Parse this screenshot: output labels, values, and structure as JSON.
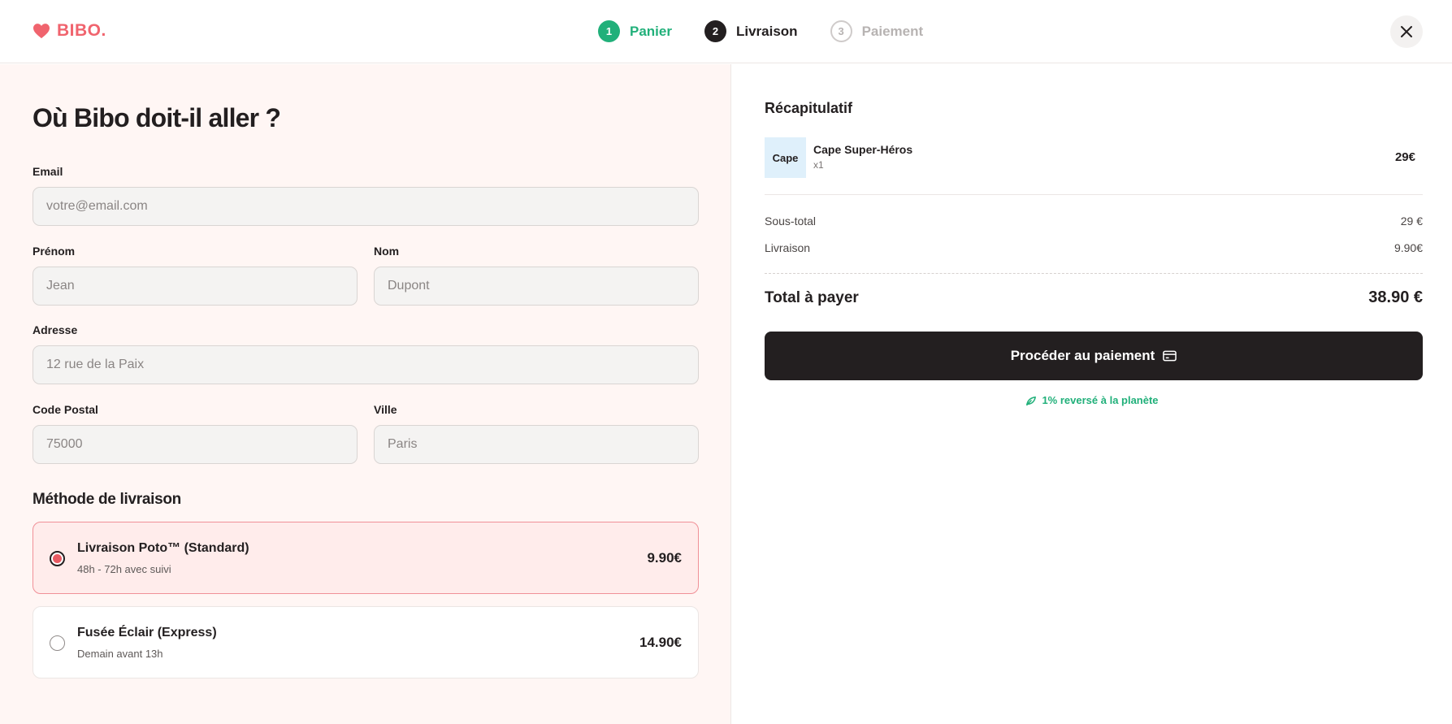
{
  "brand": {
    "name": "BIBO.",
    "color": "#f0646e"
  },
  "steps": [
    {
      "number": "1",
      "label": "Panier",
      "state": "done"
    },
    {
      "number": "2",
      "label": "Livraison",
      "state": "active"
    },
    {
      "number": "3",
      "label": "Paiement",
      "state": "pending"
    }
  ],
  "form": {
    "title": "Où Bibo doit-il aller ?",
    "email": {
      "label": "Email",
      "placeholder": "votre@email.com",
      "value": ""
    },
    "first_name": {
      "label": "Prénom",
      "placeholder": "Jean",
      "value": ""
    },
    "last_name": {
      "label": "Nom",
      "placeholder": "Dupont",
      "value": ""
    },
    "address": {
      "label": "Adresse",
      "placeholder": "12 rue de la Paix",
      "value": ""
    },
    "postal_code": {
      "label": "Code Postal",
      "placeholder": "75000",
      "value": ""
    },
    "city": {
      "label": "Ville",
      "placeholder": "Paris",
      "value": ""
    }
  },
  "shipping": {
    "title": "Méthode de livraison",
    "options": [
      {
        "name": "Livraison Poto™ (Standard)",
        "desc": "48h - 72h avec suivi",
        "price": "9.90€",
        "selected": true
      },
      {
        "name": "Fusée Éclair (Express)",
        "desc": "Demain avant 13h",
        "price": "14.90€",
        "selected": false
      }
    ]
  },
  "summary": {
    "title": "Récapitulatif",
    "item": {
      "thumb_label": "Cape",
      "name": "Cape Super-Héros",
      "qty": "x1",
      "price": "29€"
    },
    "subtotal_label": "Sous-total",
    "subtotal_value": "29 €",
    "shipping_label": "Livraison",
    "shipping_value": "9.90€",
    "total_label": "Total à payer",
    "total_value": "38.90 €",
    "pay_button": "Procéder au paiement",
    "eco_note": "1% reversé à la planète"
  },
  "colors": {
    "accent_green": "#21b07a",
    "dark": "#231f20",
    "selected_bg": "#ffeceb"
  },
  "icons": {
    "logo": "heart-icon",
    "close": "close-icon",
    "card": "credit-card-icon",
    "eco": "leaf-icon"
  }
}
